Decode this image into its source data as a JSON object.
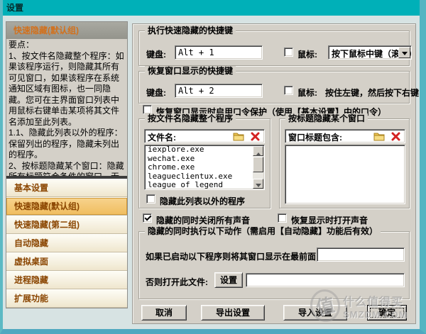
{
  "window": {
    "title": "设置"
  },
  "colors": {
    "titlebar": "#00b0b8",
    "frame": "#55b5c2",
    "panel_bg": "#d4d0c8",
    "selected_item": "#f3c877",
    "sidebar_header_text": "#d2711d",
    "item_text": "#8a4500",
    "folder_icon": "#edc352",
    "delete_icon": "#d42222"
  },
  "sidebar": {
    "header": "快速隐藏(默认组)",
    "help_text": "要点：\n1、按文件名隐藏整个程序：如果该程序运行，则隐藏其所有可见窗口，如果该程序在系统通知区域有图标，也一同隐藏。您可在主界面窗口列表中用鼠标右键单击某项将其文件名添加至此列表。\n1.1、隐藏此列表以外的程序：保留列出的程序，隐藏未列出的程序。\n2、按标题隐藏某个窗口：隐藏所有标题符合条件的窗口，无论该窗口对应的程序名称是什么。详见帮助说明。",
    "items": [
      {
        "label": "基本设置",
        "selected": false
      },
      {
        "label": "快速隐藏(默认组)",
        "selected": true
      },
      {
        "label": "快速隐藏(第二组)",
        "selected": false
      },
      {
        "label": "自动隐藏",
        "selected": false
      },
      {
        "label": "虚拟桌面",
        "selected": false
      },
      {
        "label": "进程隐藏",
        "selected": false
      },
      {
        "label": "扩展功能",
        "selected": false
      }
    ]
  },
  "main": {
    "hide_hotkey_group": {
      "title": "执行快速隐藏的快捷键",
      "keyboard_label": "键盘:",
      "keyboard_value": "Alt + 1",
      "mouse_checked": false,
      "mouse_label": "鼠标:",
      "mouse_option": "按下鼠标中键（滚轮）"
    },
    "restore_hotkey_group": {
      "title": "恢复窗口显示的快捷键",
      "keyboard_label": "键盘:",
      "keyboard_value": "Alt + 2",
      "mouse_checked": false,
      "mouse_label": "鼠标:",
      "mouse_text": "按住左键，然后按下右键"
    },
    "password_checkbox": {
      "checked": false,
      "label": "恢复窗口显示时启用口令保护（使用【基本设置】中的口令）"
    },
    "file_group": {
      "title": "按文件名隐藏整个程序",
      "list_label": "文件名:",
      "items": [
        "iexplore.exe",
        "wechat.exe",
        "chrome.exe",
        "leagueclientux.exe",
        "league of legend"
      ],
      "invert_checkbox": {
        "checked": false,
        "label": "隐藏此列表以外的程序"
      }
    },
    "title_group": {
      "title": "按标题隐藏某个窗口",
      "list_label": "窗口标题包含:"
    },
    "mute_checkbox": {
      "checked": true,
      "label": "隐藏的同时关闭所有声音"
    },
    "sound_on_checkbox": {
      "checked": false,
      "label": "恢复显示时打开声音"
    },
    "action_group": {
      "title": "隐藏的同时执行以下动作（需启用【自动隐藏】功能后有效）",
      "front_label": "如果已启动以下程序则将其窗口显示在最前面:",
      "front_value": "",
      "open_label": "否则打开此文件:",
      "set_button": "设置",
      "open_value": ""
    }
  },
  "footer": {
    "cancel": "取消",
    "export": "导出设置",
    "import": "导入设置",
    "ok": "确定"
  },
  "watermark": {
    "badge": "值",
    "line1": "什么值得买",
    "line2": "SMZDM.COM"
  }
}
